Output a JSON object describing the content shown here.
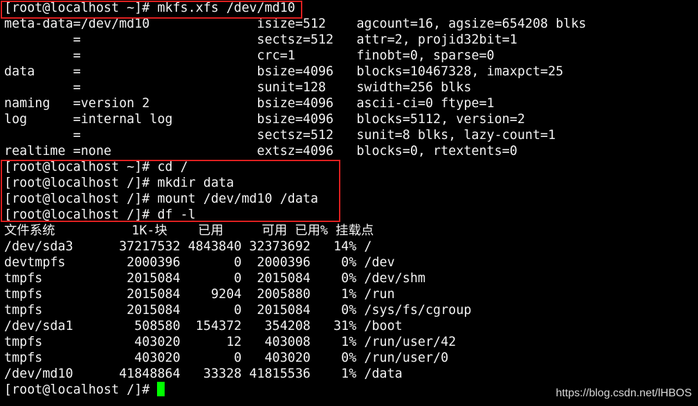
{
  "terminal": {
    "lines": [
      "[root@localhost ~]# mkfs.xfs /dev/md10",
      "meta-data=/dev/md10              isize=512    agcount=16, agsize=654208 blks",
      "         =                       sectsz=512   attr=2, projid32bit=1",
      "         =                       crc=1        finobt=0, sparse=0",
      "data     =                       bsize=4096   blocks=10467328, imaxpct=25",
      "         =                       sunit=128    swidth=256 blks",
      "naming   =version 2              bsize=4096   ascii-ci=0 ftype=1",
      "log      =internal log           bsize=4096   blocks=5112, version=2",
      "         =                       sectsz=512   sunit=8 blks, lazy-count=1",
      "realtime =none                   extsz=4096   blocks=0, rtextents=0",
      "[root@localhost ~]# cd /",
      "[root@localhost /]# mkdir data",
      "[root@localhost /]# mount /dev/md10 /data",
      "[root@localhost /]# df -l",
      "文件系统          1K-块    已用     可用 已用% 挂载点",
      "/dev/sda3      37217532 4843840 32373692   14% /",
      "devtmpfs        2000396       0  2000396    0% /dev",
      "tmpfs           2015084       0  2015084    0% /dev/shm",
      "tmpfs           2015084    9204  2005880    1% /run",
      "tmpfs           2015084       0  2015084    0% /sys/fs/cgroup",
      "/dev/sda1        508580  154372   354208   31% /boot",
      "tmpfs            403020      12   403008    1% /run/user/42",
      "tmpfs            403020       0   403020    0% /run/user/0",
      "/dev/md10      41848864   33328 41815536    1% /data"
    ],
    "prompt": "[root@localhost /]# "
  },
  "watermark": "https://blog.csdn.net/lHBOS",
  "colors": {
    "background": "#000000",
    "text": "#f2f2f2",
    "cursor": "#00ff00",
    "highlight_box": "#e02020"
  }
}
